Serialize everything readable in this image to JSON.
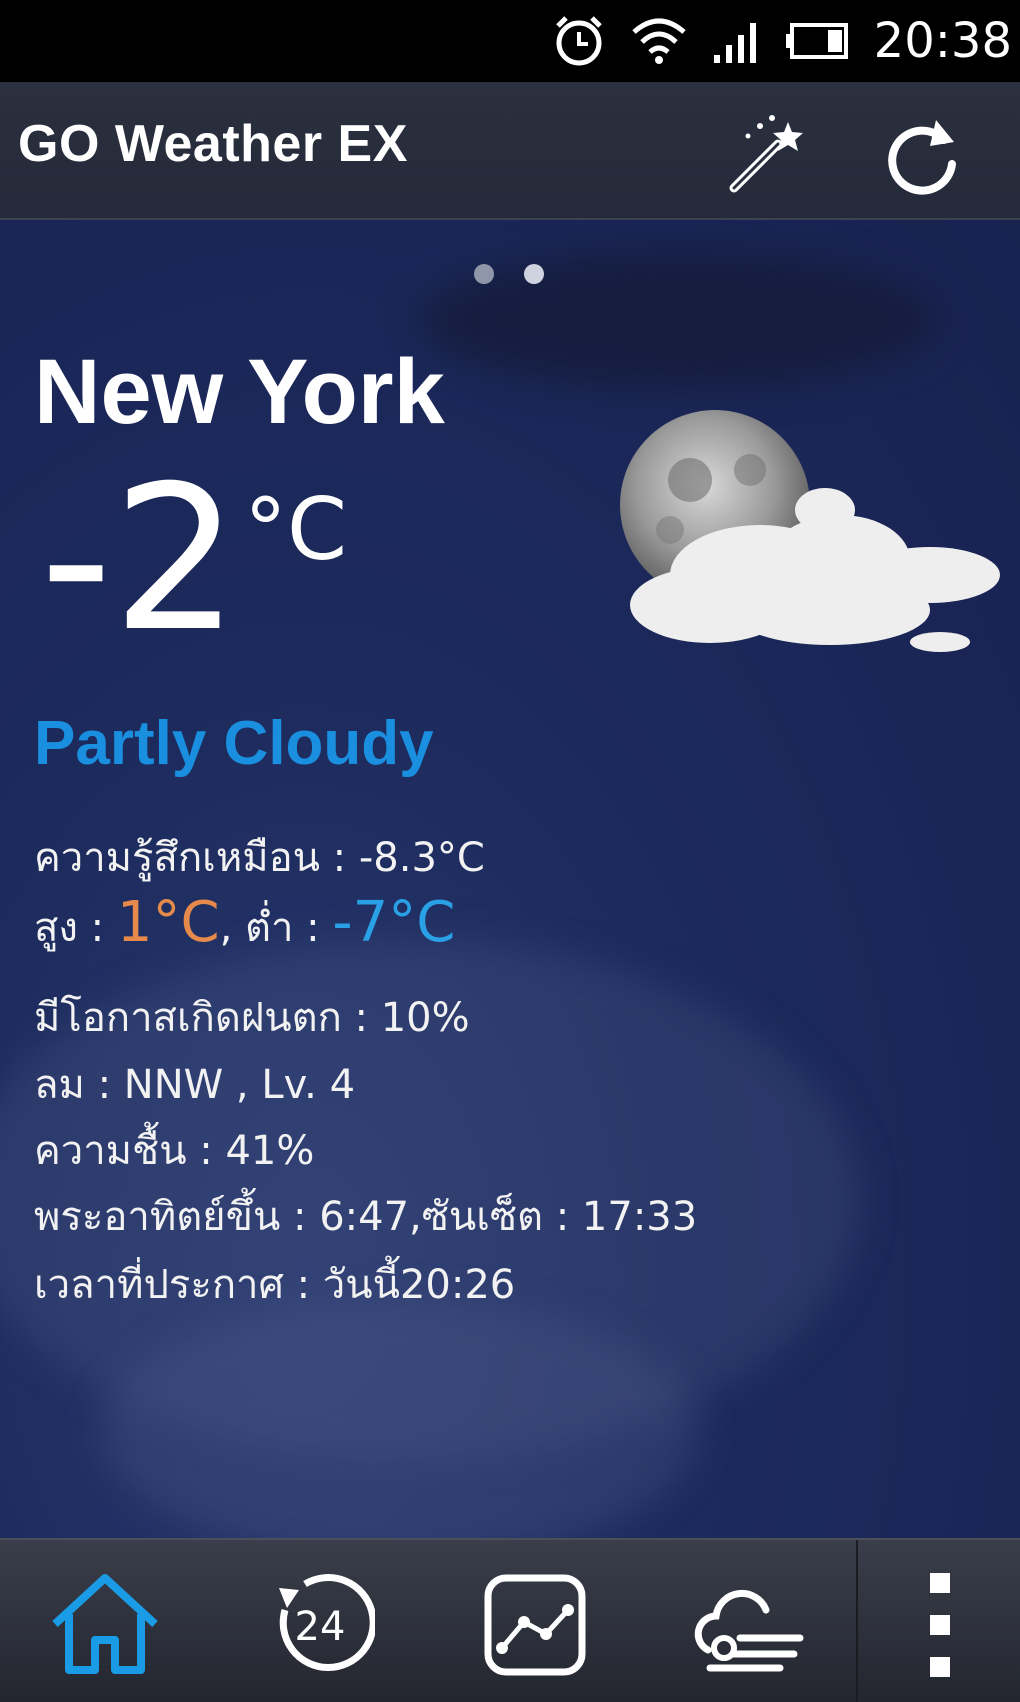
{
  "status_bar": {
    "time": "20:38"
  },
  "app": {
    "title": "GO Weather EX"
  },
  "weather": {
    "city": "New York",
    "temperature": "-2",
    "unit": "°C",
    "condition": "Partly Cloudy",
    "feels_like_label": "ความรู้สึกเหมือน : -8.3°C",
    "high_label": "สูง : ",
    "high_value": "1°C",
    "low_label": ", ต่ำ : ",
    "low_value": "-7°C",
    "rain_chance": "มีโอกาสเกิดฝนตก : 10%",
    "wind": "ลม : NNW , Lv. 4",
    "humidity": "ความชื้น : 41%",
    "sun": "พระอาทิตย์ขึ้น : 6:47,ซันเซ็ต : 17:33",
    "updated": "เวลาที่ประกาศ : วันนี้20:26"
  },
  "pager": {
    "page_count": 2,
    "active_index": 1
  },
  "tabs": [
    {
      "icon": "home-icon"
    },
    {
      "icon": "24-hour-icon"
    },
    {
      "icon": "trend-chart-icon"
    },
    {
      "icon": "wind-cloud-icon"
    },
    {
      "icon": "more-menu-icon"
    }
  ],
  "colors": {
    "accent": "#1a8fe0",
    "high": "#e58a4a",
    "low": "#2aa0e6"
  }
}
